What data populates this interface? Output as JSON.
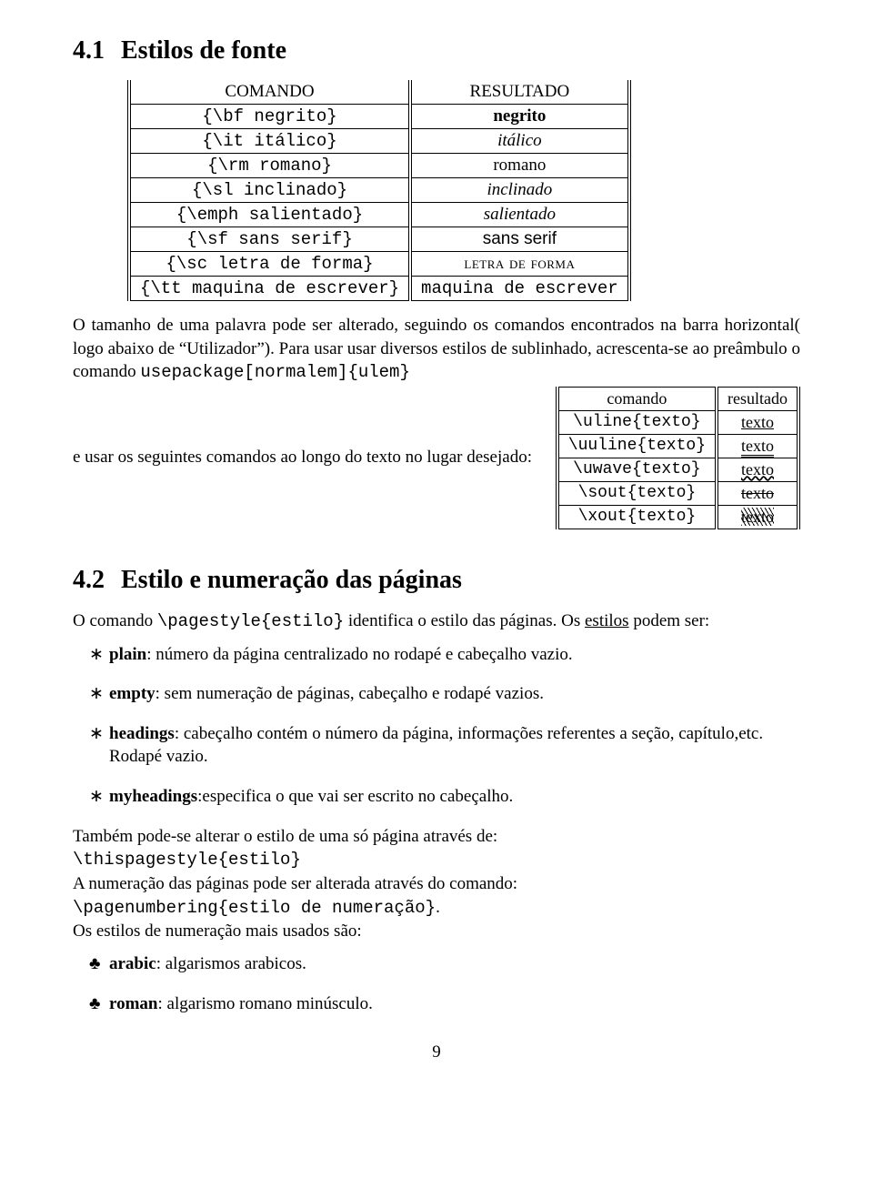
{
  "sec41": {
    "num": "4.1",
    "title": "Estilos de fonte"
  },
  "t1": {
    "h1": "COMANDO",
    "h2": "RESULTADO",
    "r": [
      {
        "c": "{\\bf negrito}",
        "v": "negrito"
      },
      {
        "c": "{\\it itálico}",
        "v": "itálico"
      },
      {
        "c": "{\\rm romano}",
        "v": "romano"
      },
      {
        "c": "{\\sl inclinado}",
        "v": "inclinado"
      },
      {
        "c": "{\\emph salientado}",
        "v": "salientado"
      },
      {
        "c": "{\\sf sans serif}",
        "v": "sans serif"
      },
      {
        "c": "{\\sc letra de forma}",
        "v": "letra de forma"
      },
      {
        "c": "{\\tt maquina de escrever}",
        "v": "maquina de escrever"
      }
    ]
  },
  "p1a": "O tamanho de uma palavra pode ser alterado, seguindo os comandos encontrados na barra horizontal( logo abaixo de “Utilizador”). Para usar usar diversos estilos de sublinhado, acrescenta-se ao preâmbulo o comando ",
  "p1b": "usepackage[normalem]{ulem}",
  "p2lead": "e usar os seguintes comandos ao longo do texto no lugar desejado:",
  "t2": {
    "h1": "comando",
    "h2": "resultado",
    "r": [
      {
        "c": "\\uline{texto}",
        "v": "texto"
      },
      {
        "c": "\\uuline{texto}",
        "v": "texto"
      },
      {
        "c": "\\uwave{texto}",
        "v": "texto"
      },
      {
        "c": "\\sout{texto}",
        "v": "texto"
      },
      {
        "c": "\\xout{texto}",
        "v": "texto"
      }
    ]
  },
  "sec42": {
    "num": "4.2",
    "title": "Estilo e numeração das páginas"
  },
  "p3a": "O comando ",
  "p3b": "\\pagestyle{estilo}",
  "p3c": " identifica o estilo das páginas. Os ",
  "p3d": "estilos",
  "p3e": " podem ser:",
  "bul": [
    {
      "b": "plain",
      "t": ": número da página centralizado no rodapé e cabeçalho vazio."
    },
    {
      "b": "empty",
      "t": ": sem numeração de páginas, cabeçalho e rodapé vazios."
    },
    {
      "b": "headings",
      "t": ": cabeçalho contém o número da página, informações referentes a seção, capítulo,etc. Rodapé vazio."
    },
    {
      "b": "myheadings",
      "t": ":especifica o que vai ser escrito no cabeçalho."
    }
  ],
  "p4a": "Também pode-se alterar o estilo de uma só página através de:",
  "p4b": "\\thispagestyle{estilo}",
  "p4c": "A numeração das páginas pode ser alterada através do comando:",
  "p4d": "\\pagenumbering{estilo de numeração}",
  "p4e": ".",
  "p4f": "Os estilos de numeração mais usados são:",
  "club": [
    {
      "b": "arabic",
      "t": ": algarismos arabicos."
    },
    {
      "b": "roman",
      "t": ": algarismo romano minúsculo."
    }
  ],
  "page": "9"
}
